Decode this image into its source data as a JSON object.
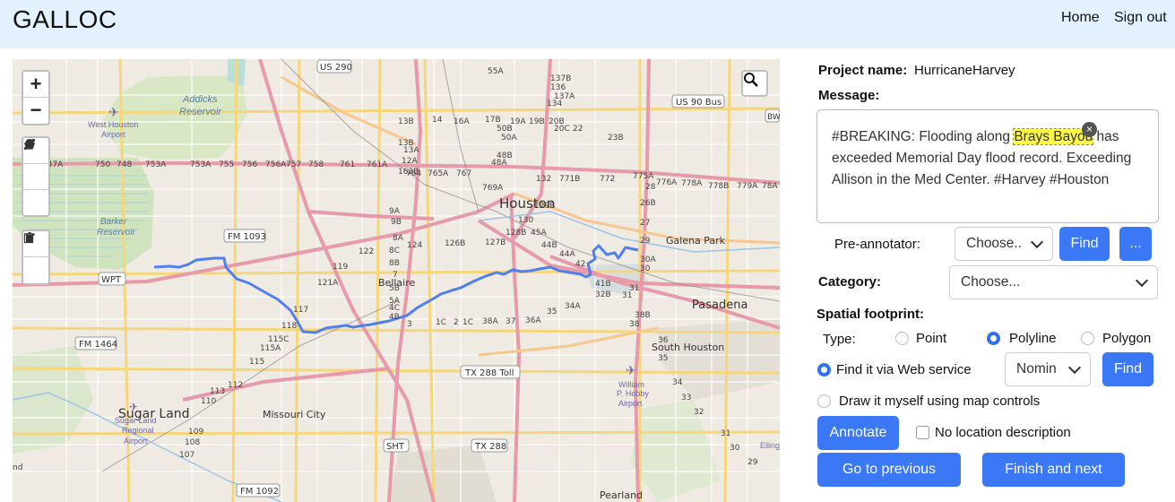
{
  "header": {
    "brand": "GALLOC",
    "nav": [
      "Home",
      "Sign out"
    ]
  },
  "map": {
    "zoom_in": "+",
    "zoom_out": "−",
    "labels": {
      "houston": "Houston",
      "bellaire": "Bellaire",
      "pasadena": "Pasadena",
      "sugar_land": "Sugar Land",
      "missouri_city": "Missouri City",
      "galena_park": "Galena Park",
      "south_houston": "South Houston",
      "pearland": "Pearland",
      "addicks_1": "Addicks",
      "addicks_2": "Reservoir",
      "barker_1": "Barker",
      "barker_2": "Reservoir",
      "whouston_1": "West Houston",
      "whouston_2": "Airport",
      "hobby_1": "William",
      "hobby_2": "P. Hobby",
      "hobby_3": "Airport",
      "sugarreg_1": "Sugar Land",
      "sugarreg_2": "Regional",
      "sugarreg_3": "Airport",
      "elling": "Elling"
    },
    "shields": [
      "US 290",
      "US 90 Bus",
      "FM 1093",
      "WPT",
      "FM 1464",
      "TX 288 Toll",
      "TX 288",
      "SHT",
      "FM 1092",
      "BW"
    ],
    "route_color": "#4f7ff0"
  },
  "project": {
    "label": "Project name:",
    "value": "HurricaneHarvey"
  },
  "message": {
    "label": "Message:",
    "before": "#BREAKING: Flooding along ",
    "highlight": "Brays Bayou",
    "after": " has exceeded Memorial Day flood record. Exceeding Allison in the Med Center. #Harvey #Houston",
    "remove": "×"
  },
  "preannotator": {
    "label": "Pre-annotator:",
    "select": "Choose..",
    "find": "Find",
    "more": "..."
  },
  "category": {
    "label": "Category:",
    "select": "Choose..."
  },
  "spatial": {
    "label": "Spatial footprint:",
    "type_label": "Type:",
    "types": [
      "Point",
      "Polyline",
      "Polygon"
    ],
    "selected_type": "Polyline",
    "find_web": "Find it via Web service",
    "service": "Nomin",
    "find": "Find",
    "draw_self": "Draw it myself using map controls"
  },
  "actions": {
    "annotate": "Annotate",
    "no_location": "No location description",
    "previous": "Go to previous",
    "next": "Finish and next"
  }
}
